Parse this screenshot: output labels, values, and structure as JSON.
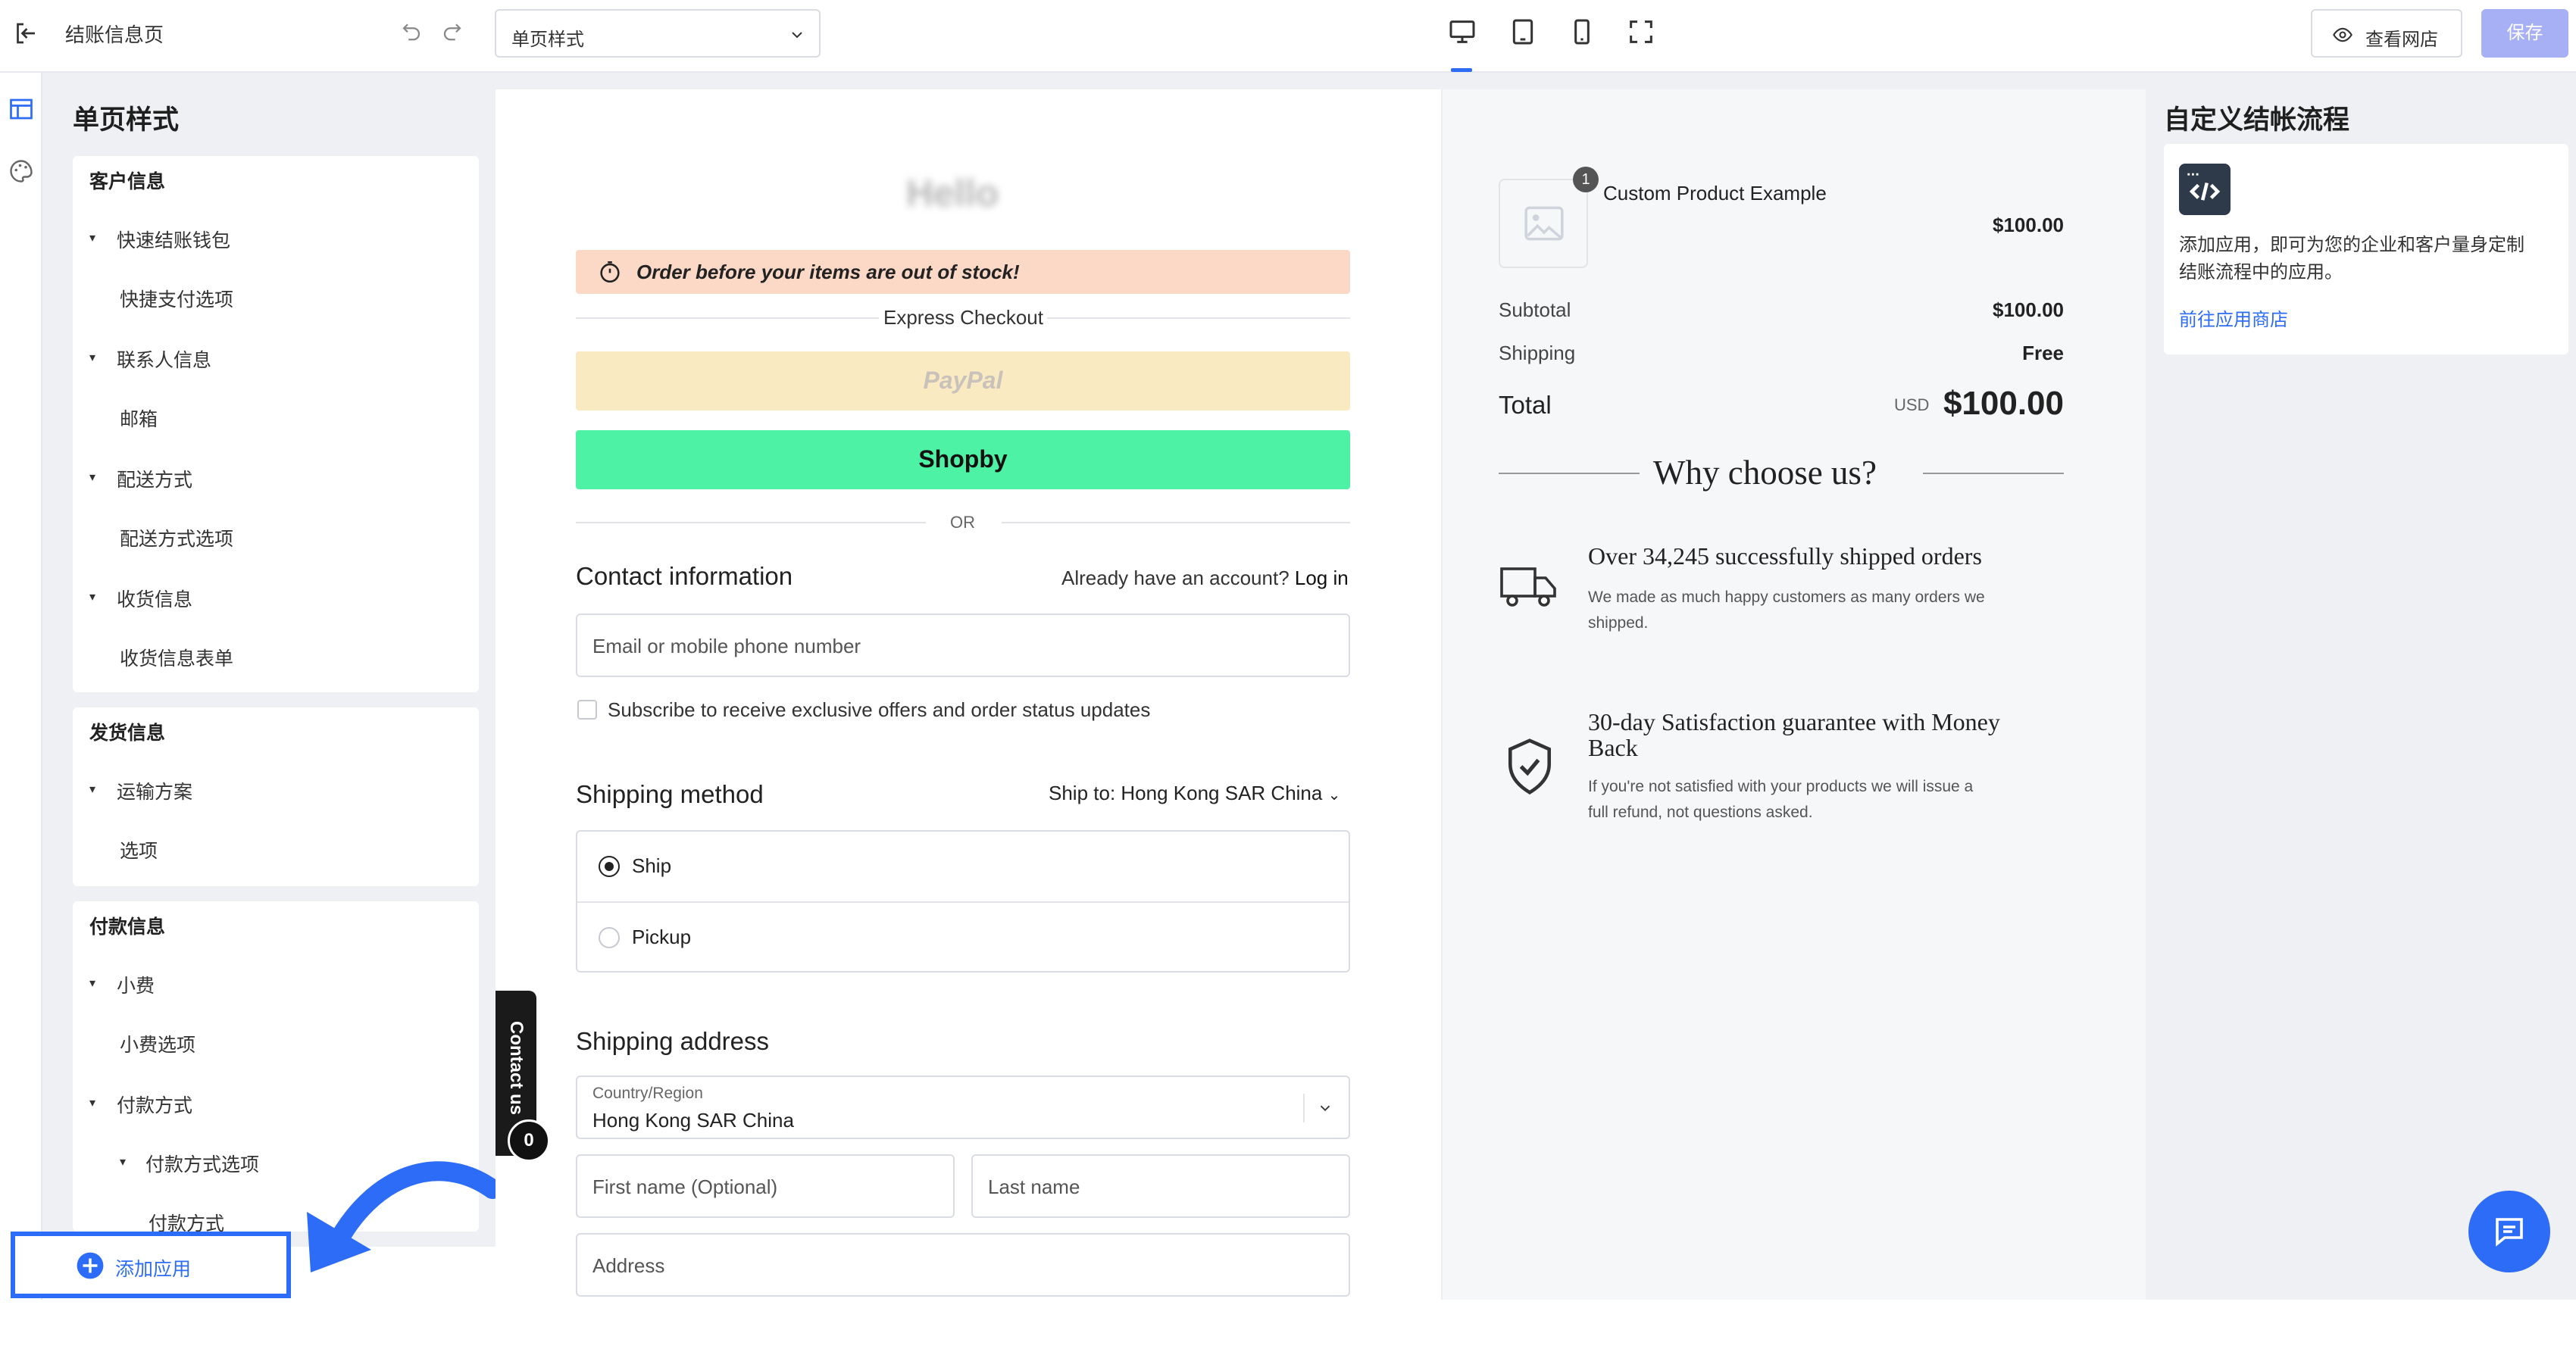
{
  "topbar": {
    "page_title": "结账信息页",
    "template_select": "单页样式",
    "view_store_label": "查看网店",
    "save_label": "保存"
  },
  "sidebar": {
    "heading": "单页样式",
    "sections": [
      {
        "title": "客户信息",
        "items": [
          "快速结账钱包",
          "快捷支付选项",
          "联系人信息",
          "邮箱",
          "配送方式",
          "配送方式选项",
          "收货信息",
          "收货信息表单"
        ]
      },
      {
        "title": "发货信息",
        "items": [
          "运输方案",
          "选项"
        ]
      },
      {
        "title": "付款信息",
        "items": [
          "小费",
          "小费选项",
          "付款方式",
          "付款方式选项",
          "付款方式"
        ]
      }
    ],
    "add_app_label": "添加应用"
  },
  "checkout": {
    "store_name": "Hello",
    "banner_text": "Order before your items are out of stock!",
    "express_checkout": "Express Checkout",
    "paypal_label": "PayPal",
    "shopby_label": "Shopby",
    "or_label": "OR",
    "contact_title": "Contact information",
    "already_account": "Already have an account?",
    "login_link": "Log in",
    "email_placeholder": "Email or mobile phone number",
    "subscribe_label": "Subscribe to receive exclusive offers and order status updates",
    "shipping_method_title": "Shipping method",
    "ship_to_label": "Ship to:",
    "ship_to_value": "Hong Kong SAR China",
    "options": [
      "Ship",
      "Pickup"
    ],
    "shipping_address_title": "Shipping address",
    "country_label": "Country/Region",
    "country_value": "Hong Kong SAR China",
    "first_name_placeholder": "First name (Optional)",
    "last_name_placeholder": "Last name",
    "address_placeholder": "Address",
    "contact_us": "Contact us",
    "contact_badge": "0"
  },
  "summary": {
    "product_name": "Custom Product Example",
    "product_qty": "1",
    "product_price": "$100.00",
    "subtotal_label": "Subtotal",
    "subtotal_value": "$100.00",
    "shipping_label": "Shipping",
    "shipping_value": "Free",
    "total_label": "Total",
    "currency": "USD",
    "total_value": "$100.00",
    "why_title": "Why choose us?",
    "benefits": [
      {
        "title": "Over 34,245 successfully shipped orders",
        "desc_line1": "We made as much happy customers as many orders we",
        "desc_line2": "shipped."
      },
      {
        "title_line1": "30-day Satisfaction guarantee with Money",
        "title_line2": "Back",
        "desc_line1": "If you're not satisfied with your products we will issue a",
        "desc_line2": "full refund, not questions asked."
      }
    ]
  },
  "rightpanel": {
    "heading": "自定义结帐流程",
    "desc_line1": "添加应用，即可为您的企业和客户量身定制",
    "desc_line2": "结账流程中的应用。",
    "link": "前往应用商店"
  },
  "colors": {
    "accent": "#2d6cf6",
    "shopby": "#4ef2a4",
    "paypal": "#faeac2",
    "banner": "#fbd9c6"
  }
}
